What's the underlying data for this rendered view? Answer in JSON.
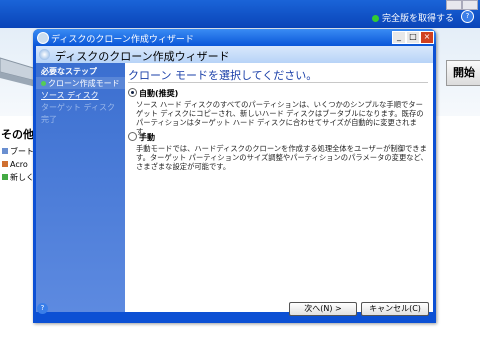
{
  "background": {
    "status_text": "完全版を取得する",
    "help_icon": "?",
    "start_button": "開始",
    "sidebar_heading": "その他",
    "sidebar_items": [
      "ブート",
      "Acro",
      "新しく"
    ]
  },
  "dialog": {
    "window_title": "ディスクのクローン作成ウィザード",
    "header_title": "ディスクのクローン作成ウィザード",
    "window_buttons": {
      "minimize": "_",
      "maximize": "□",
      "close": "×"
    },
    "steps_heading": "必要なステップ",
    "steps": [
      {
        "label": "クローン作成モード",
        "state": "current"
      },
      {
        "label": "ソース ディスク",
        "state": "link"
      },
      {
        "label": "ターゲット ディスク",
        "state": "disabled"
      },
      {
        "label": "完了",
        "state": "disabled"
      }
    ],
    "main_title": "クローン モードを選択してください。",
    "options": [
      {
        "label": "自動(推奨)",
        "selected": true,
        "description": "ソース ハード ディスクのすべてのパーティションは、いくつかのシンプルな手順でターゲット ディスクにコピーされ、新しいハード ディスクはブータブルになります。既存のパーティションはターゲット ハード ディスクに合わせてサイズが自動的に変更されます。"
      },
      {
        "label": "手動",
        "selected": false,
        "description": "手動モードでは、ハードディスクのクローンを作成する処理全体をユーザーが制御できます。ターゲット パーティションのサイズ調整やパーティションのパラメータの変更など、さまざまな設定が可能です。"
      }
    ],
    "next_button": "次へ(N) >",
    "cancel_button": "キャンセル(C)",
    "help_icon": "?"
  },
  "colors": {
    "title_bar": "#0a56d8",
    "step_panel": "#3b6fd0",
    "main_title": "#1a3fa8"
  }
}
